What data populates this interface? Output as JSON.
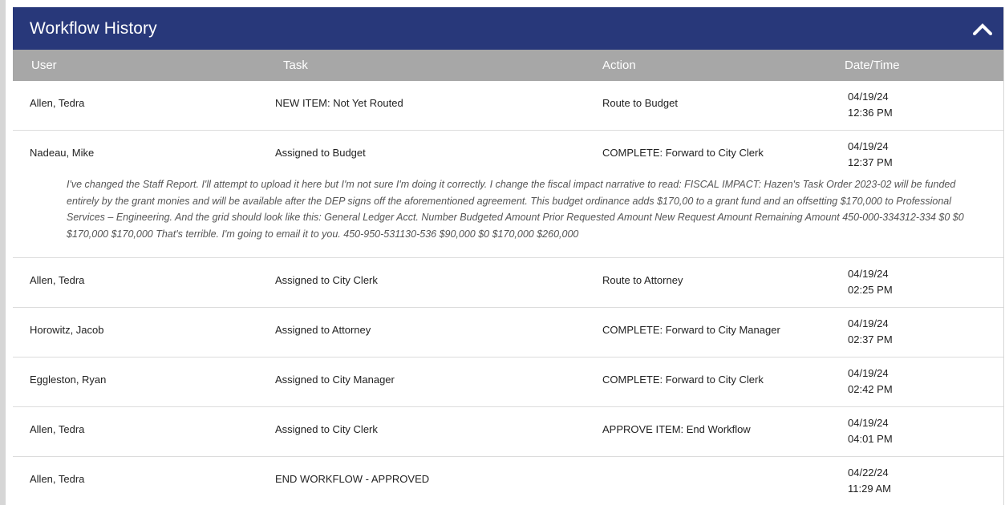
{
  "panel": {
    "title": "Workflow History",
    "collapse_icon": "chevron-up-icon"
  },
  "columns": {
    "user": "User",
    "task": "Task",
    "action": "Action",
    "datetime": "Date/Time"
  },
  "rows": [
    {
      "user": "Allen, Tedra",
      "task": "NEW ITEM: Not Yet Routed",
      "action": "Route to Budget",
      "date": "04/19/24",
      "time": "12:36 PM"
    },
    {
      "user": "Nadeau, Mike",
      "task": "Assigned to Budget",
      "action": "COMPLETE: Forward to City Clerk",
      "date": "04/19/24",
      "time": "12:37 PM",
      "comment": "I've changed the Staff Report. I'll attempt to upload it here but I'm not sure I'm doing it correctly. I change the fiscal impact narrative to read: FISCAL IMPACT: Hazen's Task Order 2023-02 will be funded entirely by the grant monies and will be available after the DEP signs off the aforementioned agreement. This budget ordinance adds $170,00 to a grant fund and an offsetting $170,000 to Professional Services – Engineering. And the grid should look like this: General Ledger Acct. Number Budgeted Amount Prior Requested Amount New Request Amount Remaining Amount 450-000-334312-334 $0 $0 $170,000 $170,000 That's terrible. I'm going to email it to you. 450-950-531130-536 $90,000 $0 $170,000 $260,000"
    },
    {
      "user": "Allen, Tedra",
      "task": "Assigned to City Clerk",
      "action": "Route to Attorney",
      "date": "04/19/24",
      "time": "02:25 PM"
    },
    {
      "user": "Horowitz, Jacob",
      "task": "Assigned to Attorney",
      "action": "COMPLETE: Forward to City Manager",
      "date": "04/19/24",
      "time": "02:37 PM"
    },
    {
      "user": "Eggleston, Ryan",
      "task": "Assigned to City Manager",
      "action": "COMPLETE: Forward to City Clerk",
      "date": "04/19/24",
      "time": "02:42 PM"
    },
    {
      "user": "Allen, Tedra",
      "task": "Assigned to City Clerk",
      "action": "APPROVE ITEM: End Workflow",
      "date": "04/19/24",
      "time": "04:01 PM"
    },
    {
      "user": "Allen, Tedra",
      "task": "END WORKFLOW - APPROVED",
      "action": "",
      "date": "04/22/24",
      "time": "11:29 AM"
    }
  ]
}
